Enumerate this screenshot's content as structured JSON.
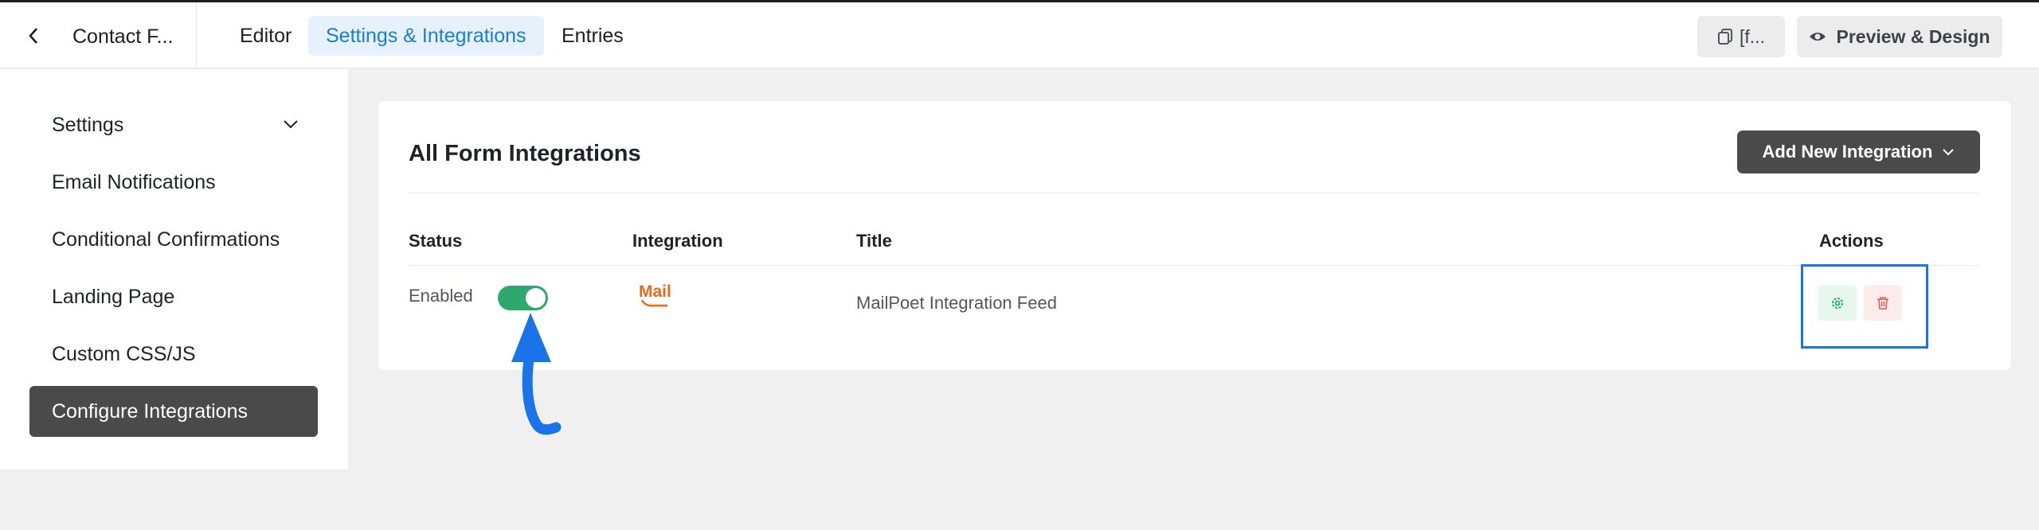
{
  "header": {
    "back_icon": "chevron-left-icon",
    "form_name": "Contact F...",
    "tabs": [
      {
        "label": "Editor",
        "active": false
      },
      {
        "label": "Settings & Integrations",
        "active": true
      },
      {
        "label": "Entries",
        "active": false
      }
    ],
    "shortcode_label": "[f...",
    "shortcode_icon": "copy-icon",
    "preview_label": "Preview & Design",
    "preview_icon": "eye-icon"
  },
  "sidebar": {
    "items": [
      {
        "label": "Settings",
        "has_chevron": true,
        "active": false
      },
      {
        "label": "Email Notifications",
        "active": false
      },
      {
        "label": "Conditional Confirmations",
        "active": false
      },
      {
        "label": "Landing Page",
        "active": false
      },
      {
        "label": "Custom CSS/JS",
        "active": false
      },
      {
        "label": "Configure Integrations",
        "active": true
      }
    ]
  },
  "main": {
    "title": "All Form Integrations",
    "add_button_label": "Add New Integration",
    "columns": [
      "Status",
      "Integration",
      "Title",
      "Actions"
    ],
    "rows": [
      {
        "status_text": "Enabled",
        "enabled": true,
        "integration_logo_text": "Mail",
        "title": "MailPoet Integration Feed",
        "actions": [
          "settings-icon",
          "trash-icon"
        ]
      }
    ]
  },
  "colors": {
    "accent": "#1a7dd6",
    "toggle_on": "#2fa86c",
    "sidebar_active": "#4a4a4a",
    "annotation": "#1a73e8",
    "mailpoet_orange": "#e86a1a"
  }
}
